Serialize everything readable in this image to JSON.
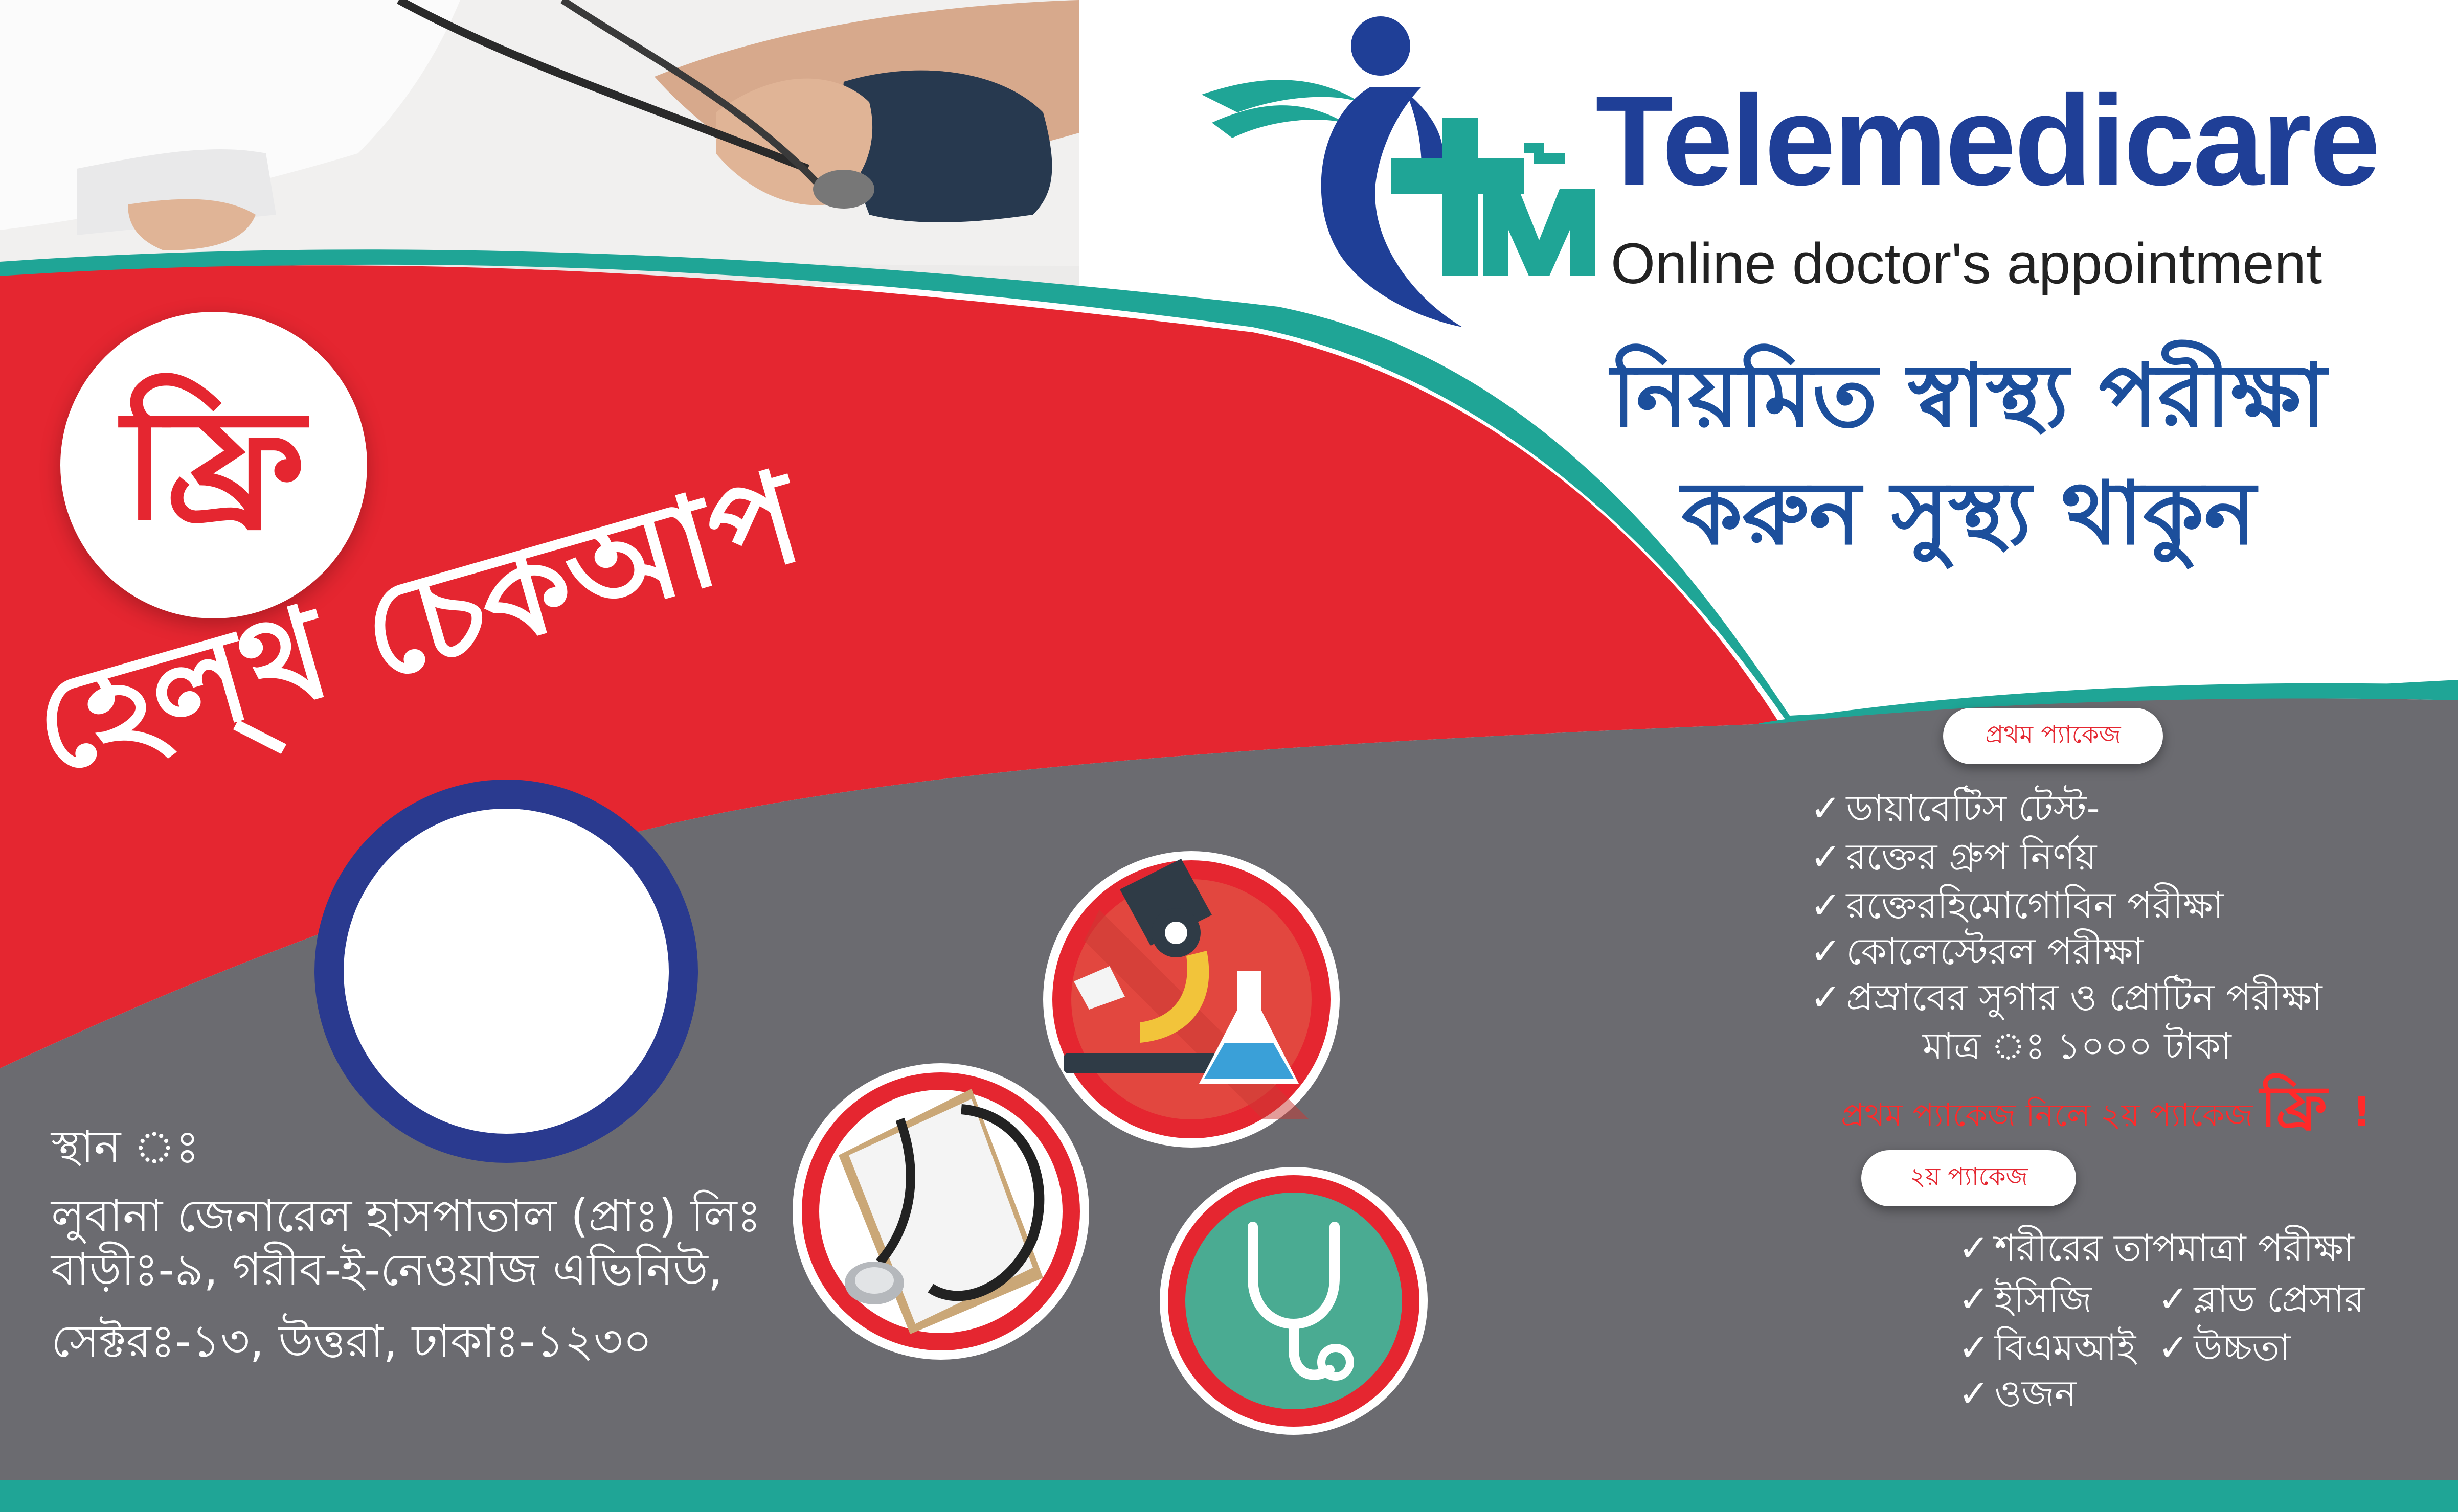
{
  "brand": {
    "name": "Telemedicare",
    "tagline": "Online doctor's appointment",
    "logo_letters": "TM"
  },
  "slogan": {
    "line1": "নিয়মিত স্বাস্থ্য পরীক্ষা",
    "line2": "করুন সুস্থ্য থাকুন"
  },
  "badge": {
    "text": "ফ্রি"
  },
  "headline": "হেল্থ চেকআপ",
  "location": {
    "label": "স্থান ঃ",
    "line1": "লুবানা জেনারেল হাসপাতাল (প্রাঃ) লিঃ",
    "line2": "বাড়ীঃ-৯, গরীব-ই-নেওয়াজ এভিনিউ,",
    "line3": "সেক্টরঃ-১৩, উত্তরা, ঢাকাঃ-১২৩০"
  },
  "package1": {
    "label": "প্রথম প্যাকেজ",
    "items": [
      "ডায়াবেটিস টেস্ট-",
      "রক্তের গ্রুপ  নির্ণয়",
      "রক্তেরহিমোগোবিন পরীক্ষা",
      "কোলেস্টেরল পরীক্ষা",
      "প্রস্রাবের সুগার ও প্রোটিন পরীক্ষা"
    ],
    "price": "মাত্র ঃ ১০০০ টাকা",
    "offer": "প্রথম প্যাকেজ নিলে ২য় প্যাকেজ",
    "offer_free": "ফ্রি",
    "offer_mark": "!"
  },
  "package2": {
    "label": "২য় প্যাকেজ",
    "items": [
      "শরীরের তাপমাত্রা পরীক্ষা",
      "ইসিজি",
      "ব্লাড প্রেসার",
      "বিএমআই",
      "উচ্চতা",
      "ওজন"
    ]
  },
  "tick": "✓",
  "colors": {
    "red": "#e52630",
    "gray": "#6b6b70",
    "teal": "#1fa596",
    "blue": "#1f3f97",
    "navy_ring": "#2a3a8f",
    "icon_red": "#e2473f",
    "icon_teal": "#4aab92"
  },
  "icons": [
    "blood-pressure-photo",
    "microscope-icon",
    "stethoscope-icon",
    "clipboard-stethoscope-icon"
  ]
}
